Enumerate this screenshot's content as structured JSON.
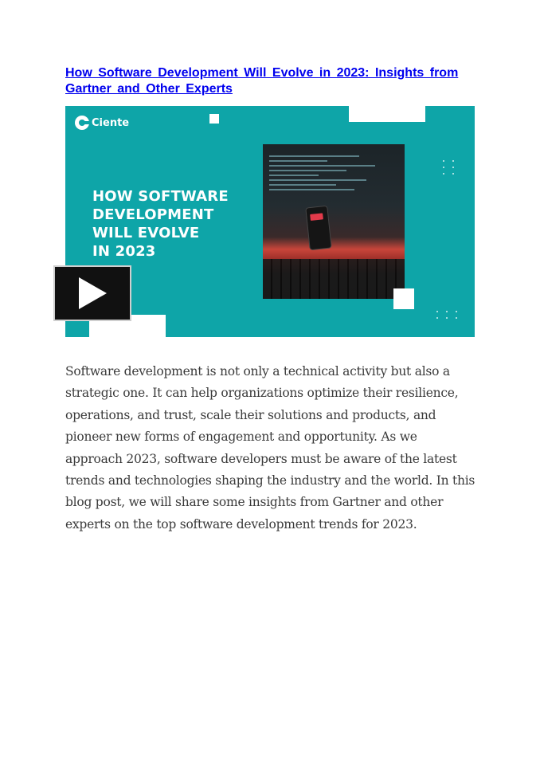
{
  "article": {
    "title_line1": "How Software Development Will Evolve in 2023: Insights from",
    "title_line2": "Gartner and Other Experts",
    "body": "Software development is not only a technical activity but also a strategic one. It can help organizations optimize their resilience, operations, and trust, scale their solutions and products, and pioneer new forms of engagement and opportunity. As we approach 2023, software developers must be aware of the latest trends and technologies shaping the industry and the world. In this blog post, we will share some insights from Gartner and other experts on the top software development trends for 2023."
  },
  "banner": {
    "brand": "Ciente",
    "headline_lines": [
      "HOW SOFTWARE",
      "DEVELOPMENT",
      "WILL EVOLVE",
      "IN 2023"
    ],
    "background_color": "#0ea5a8"
  },
  "player": {
    "icon": "play-icon"
  }
}
